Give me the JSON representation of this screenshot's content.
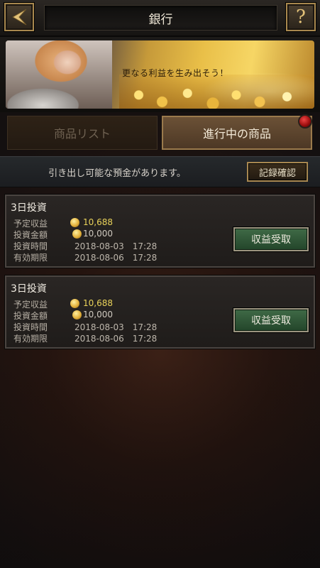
{
  "header": {
    "title": "銀行",
    "back_icon": "back-arrow-icon",
    "help_label": "?"
  },
  "banner": {
    "text": "更なる利益を生み出そう！"
  },
  "tabs": [
    {
      "label": "商品リスト",
      "active": false
    },
    {
      "label": "進行中の商品",
      "active": true,
      "has_notification": true
    }
  ],
  "notice": {
    "text": "引き出し可能な預金があります。",
    "button_label": "記録確認"
  },
  "investments": [
    {
      "title": "3日投資",
      "expected_profit_label": "予定収益",
      "expected_profit": "10,688",
      "amount_label": "投資金額",
      "amount": "10,000",
      "invest_time_label": "投資時間",
      "invest_time": "2018-08-03　17:28",
      "expiry_label": "有効期限",
      "expiry": "2018-08-06　17:28",
      "claim_label": "収益受取"
    },
    {
      "title": "3日投資",
      "expected_profit_label": "予定収益",
      "expected_profit": "10,688",
      "amount_label": "投資金額",
      "amount": "10,000",
      "invest_time_label": "投資時間",
      "invest_time": "2018-08-03　17:28",
      "expiry_label": "有効期限",
      "expiry": "2018-08-06　17:28",
      "claim_label": "収益受取"
    }
  ],
  "colors": {
    "accent_gold": "#ead35a",
    "frame_gold": "#a88850",
    "claim_green": "#23452a",
    "notification_red": "#cc1a1a"
  }
}
